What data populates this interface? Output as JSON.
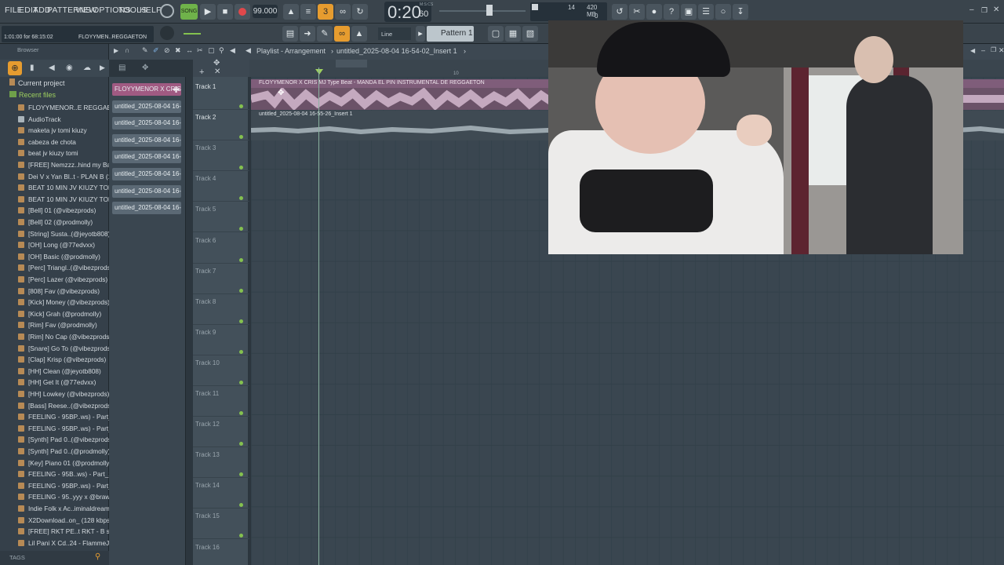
{
  "menu": [
    "FILE",
    "EDIT",
    "ADD",
    "PATTERNS",
    "VIEW",
    "OPTIONS",
    "TOOLS",
    "HELP"
  ],
  "transport": {
    "song_label": "SONG",
    "tempo": "99.000",
    "time_display": "0:20",
    "time_sub": "60",
    "time_unit": "M:S:CS",
    "cpu_value": "14",
    "ram_value": "420 MB",
    "voices": "0"
  },
  "hint": {
    "position": "1:01:00 for 68:15:02",
    "project": "FLOYYMEN..REGGAETON"
  },
  "toolbar2": {
    "snap": "Line",
    "pattern": "Pattern 1"
  },
  "browser": {
    "title": "Browser",
    "current_project": "Current project",
    "recent_files": "Recent files",
    "items": [
      "FLOYYMENOR..E REGGAETON",
      "AudioTrack",
      "maketa jv tomi kiuzy",
      "cabeza de chota",
      "beat jv kiuzy tomi",
      "[FREE] Nemzzz..hind my Back",
      "Dei V x Yan Bl..t - PLAN B (1)",
      "BEAT 10 MIN JV KIUZY TOMI",
      "BEAT 10 MIN JV KIUZY TOMI",
      "[Bell] 01 (@vibezprods)",
      "[Bell] 02 (@prodmolly)",
      "[String] Susta..(@jeyotb808)",
      "[OH] Long (@77edvxx)",
      "[OH] Basic (@prodmolly)",
      "[Perc] Triangl..(@vibezprods)",
      "[Perc] Lazer (@vibezprods)",
      "[808] Fav (@vibezprods)",
      "[Kick] Money (@vibezprods)",
      "[Kick] Grah (@prodmolly)",
      "[Rim] Fav (@prodmolly)",
      "[Rim] No Cap (@vibezprods)",
      "[Snare] Go To (@vibezprods)",
      "[Clap] Krisp (@vibezprods)",
      "[HH] Clean (@jeyotb808)",
      "[HH] Get It (@77edvxx)",
      "[HH] Lowkey (@vibezprods)",
      "[Bass] Reese..(@vibezprods)",
      "FEELING - 95BP..ws) - Part_4",
      "FEELING - 95BP..ws) - Part_3",
      "[Synth] Pad 0..(@vibezprods)",
      "[Synth] Pad 0..(@prodmolly)",
      "[Key] Piano 01 (@prodmolly)",
      "FEELING - 95B..ws) - Part_2",
      "FEELING - 95BP..ws) - Part_1",
      "FEELING - 95..yyy x @brawss",
      "Indie Folk x Ac..iminaldream",
      "X2Download..on_ (128 kbps)",
      "[FREE] RKT PE..t RKT - B side",
      "Lil Pani X Cd..24 - FlammeJCP"
    ],
    "tags_label": "TAGS"
  },
  "clips": [
    "FLOYYMENOR X CRIS...",
    "untitled_2025-08-04 16-...",
    "untitled_2025-08-04 16-...",
    "untitled_2025-08-04 16-...",
    "untitled_2025-08-04 16-...",
    "untitled_2025-08-04 16-...",
    "untitled_2025-08-04 16-...",
    "untitled_2025-08-04 16-..."
  ],
  "playlist": {
    "title": "Playlist - Arrangement",
    "breadcrumb": "untitled_2025-08-04 16-54-02_Insert 1",
    "ruler_mark": "10",
    "tracks": [
      "Track 1",
      "Track 2",
      "Track 3",
      "Track 4",
      "Track 5",
      "Track 6",
      "Track 7",
      "Track 8",
      "Track 9",
      "Track 10",
      "Track 11",
      "Track 12",
      "Track 13",
      "Track 14",
      "Track 15",
      "Track 16"
    ],
    "clip1_label": "FLOYYMENOR X CRIS MJ Type Beat - MANDA EL PIN  INSTRUMENTAL DE REGGAETON",
    "clip2_label": "untitled_2025-08-04 16-55-26_Insert 1"
  },
  "colors": {
    "accent_orange": "#e69c2f",
    "clip_pink": "#a05a82",
    "led_green": "#84c14f"
  }
}
